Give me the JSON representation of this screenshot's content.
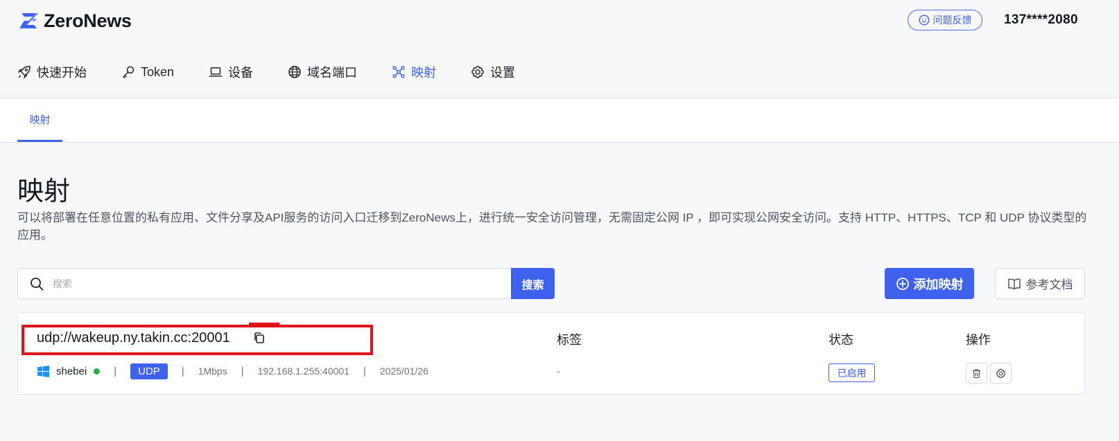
{
  "header": {
    "brand": "ZeroNews",
    "feedback_label": "问题反馈",
    "user": "137****2080"
  },
  "nav": {
    "items": [
      {
        "label": "快速开始",
        "icon": "rocket-icon"
      },
      {
        "label": "Token",
        "icon": "key-icon"
      },
      {
        "label": "设备",
        "icon": "laptop-icon"
      },
      {
        "label": "域名端口",
        "icon": "globe-icon"
      },
      {
        "label": "映射",
        "icon": "network-icon",
        "active": true
      },
      {
        "label": "设置",
        "icon": "gear-icon"
      }
    ]
  },
  "subtabs": [
    {
      "label": "映射",
      "active": true
    }
  ],
  "page": {
    "title": "映射",
    "description": "可以将部署在任意位置的私有应用、文件分享及API服务的访问入口迁移到ZeroNews上，进行统一安全访问管理，无需固定公网 IP ，即可实现公网安全访问。支持 HTTP、HTTPS、TCP 和 UDP 协议类型的应用。"
  },
  "search": {
    "placeholder": "搜索",
    "button_label": "搜索"
  },
  "actions": {
    "add_label": "添加映射",
    "docs_label": "参考文档"
  },
  "table": {
    "headers": {
      "tags": "标签",
      "status": "状态",
      "operations": "操作"
    },
    "rows": [
      {
        "address": "udp://wakeup.ny.takin.cc:20001",
        "device": "shebei",
        "device_online": true,
        "protocol": "UDP",
        "bandwidth": "1Mbps",
        "target": "192.168.1.255:40001",
        "date": "2025/01/26",
        "tags": "-",
        "status": "已启用"
      }
    ]
  },
  "colors": {
    "accent": "#3e62ee",
    "online": "#22b14c",
    "highlight": "#e0121b"
  }
}
